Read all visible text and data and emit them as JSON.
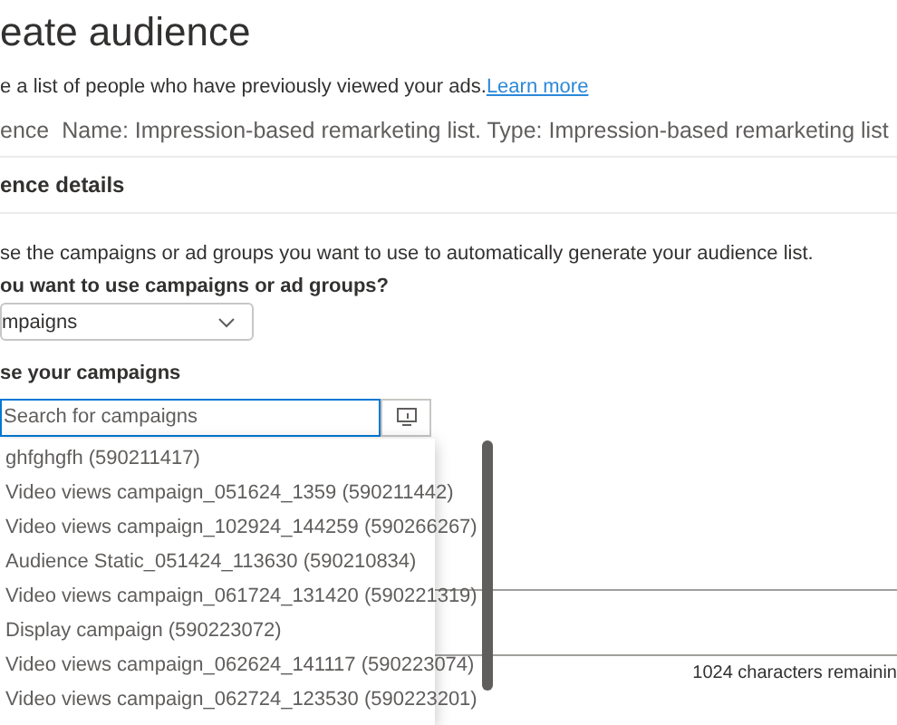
{
  "title": "eate audience",
  "description": {
    "text": "e a list of people who have previously viewed your ads.",
    "link": "Learn more"
  },
  "audience_row": {
    "label": "ence",
    "value": "Name: Impression-based remarketing list. Type: Impression-based remarketing list"
  },
  "section_title": "ence details",
  "instructions": "se the campaigns or ad groups you want to use to automatically generate your audience list.",
  "question": "ou want to use campaigns or ad groups?",
  "select": {
    "value": "mpaigns"
  },
  "campaigns_label": "se your campaigns",
  "search": {
    "placeholder": "Search for campaigns"
  },
  "options": [
    {
      "label": "ghfghgfh (590211417)"
    },
    {
      "label": "Video views campaign_051624_1359 (590211442)"
    },
    {
      "label": "Video views campaign_102924_144259 (590266267)"
    },
    {
      "label": "Audience Static_051424_113630 (590210834)"
    },
    {
      "label": "Video views campaign_061724_131420 (590221319)"
    },
    {
      "label": "Display campaign (590223072)"
    },
    {
      "label": "Video views campaign_062624_141117 (590223074)"
    },
    {
      "label": "Video views campaign_062724_123530 (590223201)"
    }
  ],
  "char_count": "1024 characters remainin"
}
